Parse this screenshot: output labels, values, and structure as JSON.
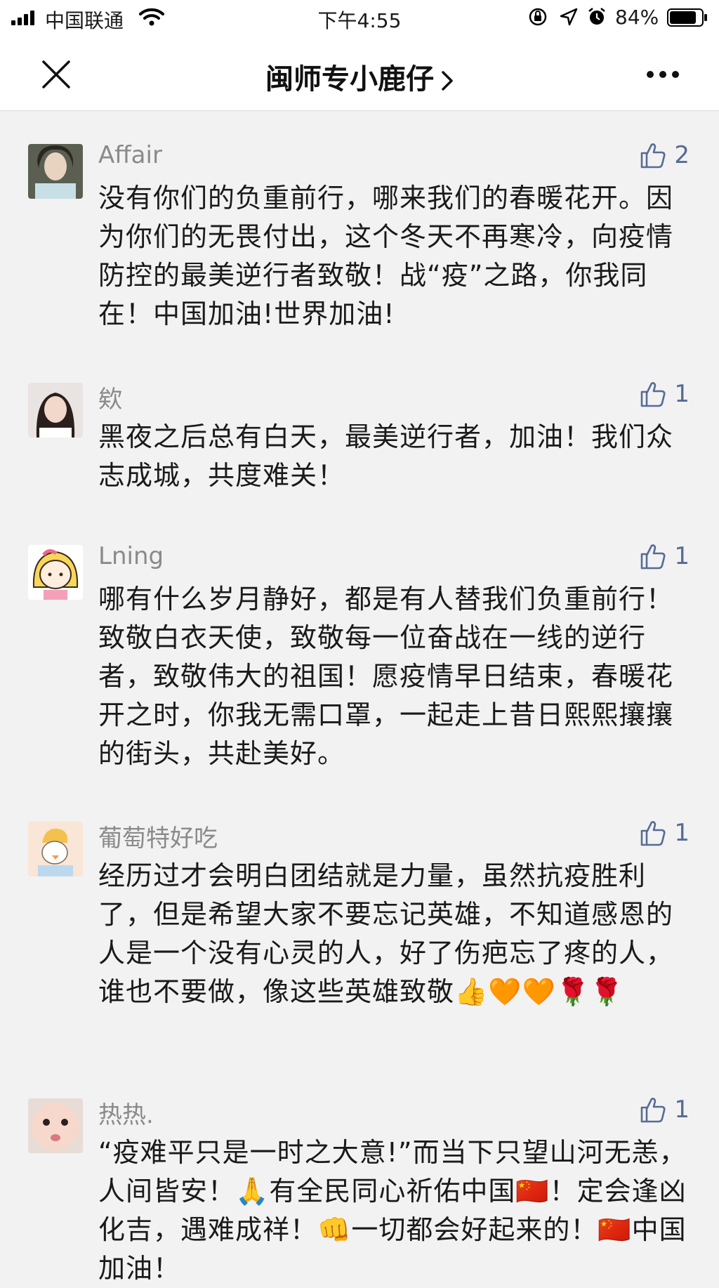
{
  "status_bar": {
    "carrier": "中国联通",
    "time": "下午4:55",
    "battery_percent": "84%",
    "battery_level": 0.84
  },
  "nav": {
    "title": "闽师专小鹿仔",
    "chevron": "›"
  },
  "comments": [
    {
      "name": "Affair",
      "likes": "2",
      "text": "没有你们的负重前行，哪来我们的春暖花开。因为你们的无畏付出，这个冬天不再寒冷，向疫情防控的最美逆行者致敬！战“疫”之路，你我同在！中国加油!世界加油!"
    },
    {
      "name": "欸",
      "likes": "1",
      "text": "黑夜之后总有白天，最美逆行者，加油！我们众志成城，共度难关！"
    },
    {
      "name": "Lning",
      "likes": "1",
      "text": "哪有什么岁月静好，都是有人替我们负重前行！致敬白衣天使，致敬每一位奋战在一线的逆行者，致敬伟大的祖国！愿疫情早日结束，春暖花开之时，你我无需口罩，一起走上昔日熙熙攘攘的街头，共赴美好。"
    },
    {
      "name": "葡萄特好吃",
      "likes": "1",
      "text": "经历过才会明白团结就是力量，虽然抗疫胜利了，但是希望大家不要忘记英雄，不知道感恩的人是一个没有心灵的人，好了伤疤忘了疼的人，谁也不要做，像这些英雄致敬👍🧡🧡🌹🌹"
    },
    {
      "name": "热热.",
      "likes": "1",
      "text": "“疫难平只是一时之大意!”而当下只望山河无恙，人间皆安！🙏有全民同心祈佑中国🇨🇳！定会逢凶化吉，遇难成祥！👊一切都会好起来的！🇨🇳中国加油！"
    }
  ],
  "icons": {
    "signal": "signal-icon",
    "wifi": "wifi-icon",
    "orientation_lock": "orientation-lock-icon",
    "location": "location-arrow-icon",
    "alarm": "alarm-icon",
    "battery": "battery-icon",
    "close": "close-icon",
    "more": "more-icon",
    "like": "thumbs-up-icon"
  },
  "colors": {
    "link_blue": "#576b95",
    "name_gray": "#8a8a8a",
    "background": "#f2f2f2"
  }
}
